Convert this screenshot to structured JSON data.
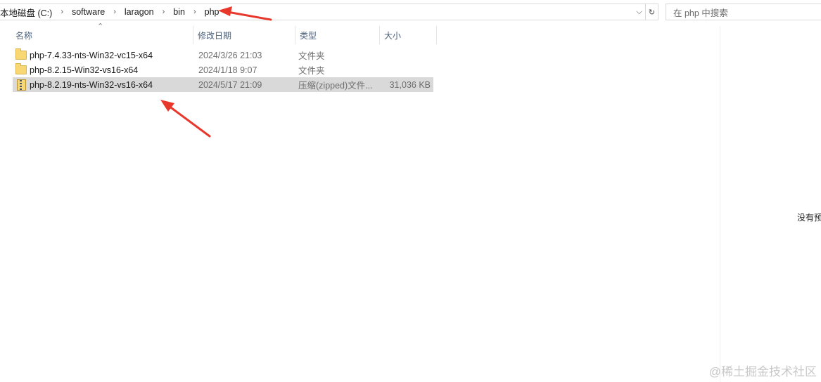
{
  "breadcrumb": {
    "items": [
      "本地磁盘 (C:)",
      "software",
      "laragon",
      "bin",
      "php"
    ],
    "separator": "›"
  },
  "address_controls": {
    "dropdown_glyph": "⌵",
    "refresh_glyph": "↻"
  },
  "search": {
    "placeholder": "在 php 中搜索"
  },
  "columns": {
    "name": "名称",
    "date": "修改日期",
    "type": "类型",
    "size": "大小",
    "sort_glyph": "⌃"
  },
  "files": [
    {
      "name": "php-7.4.33-nts-Win32-vc15-x64",
      "date": "2024/3/26 21:03",
      "type": "文件夹",
      "size": "",
      "icon": "folder-icon",
      "selected": false
    },
    {
      "name": "php-8.2.15-Win32-vs16-x64",
      "date": "2024/1/18 9:07",
      "type": "文件夹",
      "size": "",
      "icon": "folder-icon",
      "selected": false
    },
    {
      "name": "php-8.2.19-nts-Win32-vs16-x64",
      "date": "2024/5/17 21:09",
      "type": "压缩(zipped)文件...",
      "size": "31,036 KB",
      "icon": "zip-archive-icon",
      "selected": true
    }
  ],
  "preview": {
    "text": "没有预"
  },
  "watermark": "@稀土掘金技术社区",
  "colors": {
    "annotation_arrow": "#e8382c",
    "selection": "#d9d9d9",
    "header_text": "#4c607a"
  }
}
